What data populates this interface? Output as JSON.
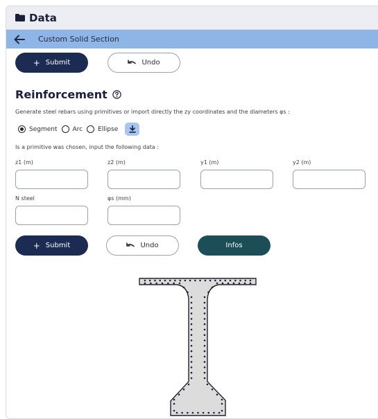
{
  "header": {
    "title": "Data",
    "icon": "folder-icon"
  },
  "subheader": {
    "title": "Custom Solid Section",
    "back_icon": "arrow-left-icon"
  },
  "top_actions": {
    "submit_label": "Submit",
    "undo_label": "Undo"
  },
  "reinforcement": {
    "title": "Reinforcement",
    "help_icon": "question-circle-icon",
    "description": "Generate steel rebars using primitives or import directly the zy coordinates and the diameters φs :",
    "options": [
      {
        "label": "Segment",
        "selected": true
      },
      {
        "label": "Arc",
        "selected": false
      },
      {
        "label": "Ellipse",
        "selected": false
      }
    ],
    "import_icon": "download-icon",
    "primitive_note": "Is a primitive was chosen, input the following data :",
    "fields": {
      "z1": {
        "label": "z1 (m)",
        "value": ""
      },
      "z2": {
        "label": "z2 (m)",
        "value": ""
      },
      "y1": {
        "label": "y1 (m)",
        "value": ""
      },
      "y2": {
        "label": "y2 (m)",
        "value": ""
      },
      "n_steel": {
        "label": "N steel",
        "value": ""
      },
      "phi_s": {
        "label": "φs (mm)",
        "value": ""
      }
    },
    "submit_label": "Submit",
    "undo_label": "Undo",
    "infos_label": "Infos"
  },
  "colors": {
    "header_bg": "#eceef3",
    "subheader_bg": "#8fb4e6",
    "submit_bg": "#1c2b52",
    "infos_bg": "#1b4e56",
    "import_bg": "#a9c5f0",
    "section_fill": "#dcdcdc"
  }
}
